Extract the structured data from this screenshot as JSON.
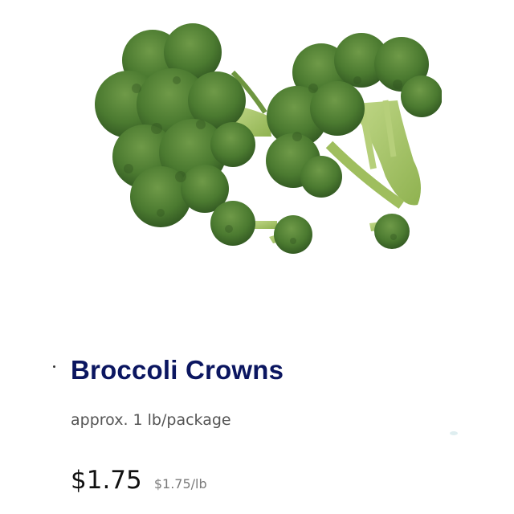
{
  "product": {
    "name": "Broccoli Crowns",
    "size": "approx. 1 lb/package",
    "price": "$1.75",
    "unit_price": "$1.75/lb",
    "image_icon": "broccoli-image"
  },
  "colors": {
    "title": "#0b1660",
    "floret_dark": "#3f6b2a",
    "floret_mid": "#557f35",
    "stem": "#a7c46a"
  }
}
